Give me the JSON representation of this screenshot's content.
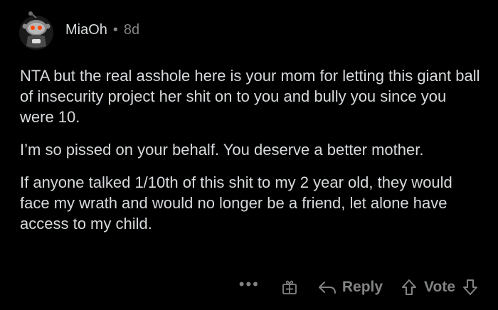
{
  "comment": {
    "username": "MiaOh",
    "separator": "•",
    "age": "8d",
    "avatar_icon": "snoo-avatar-icon",
    "paragraphs": [
      "NTA but the real asshole here is your mom for letting this giant ball of insecurity project her shit on to you and bully you since you were 10.",
      "I’m so pissed on your behalf. You deserve a better mother.",
      "If anyone talked 1/10th of this shit to my 2 year old, they would face my wrath and would no longer be a friend, let alone have access to my child."
    ]
  },
  "actions": {
    "more_label": "•••",
    "gift_icon": "gift-icon",
    "reply_icon": "reply-arrow-icon",
    "reply_label": "Reply",
    "upvote_icon": "upvote-arrow-icon",
    "vote_label": "Vote",
    "downvote_icon": "downvote-arrow-icon"
  },
  "colors": {
    "background": "#000000",
    "text": "#d7dadc",
    "muted": "#818384",
    "avatar_accent": "#ff4500"
  }
}
